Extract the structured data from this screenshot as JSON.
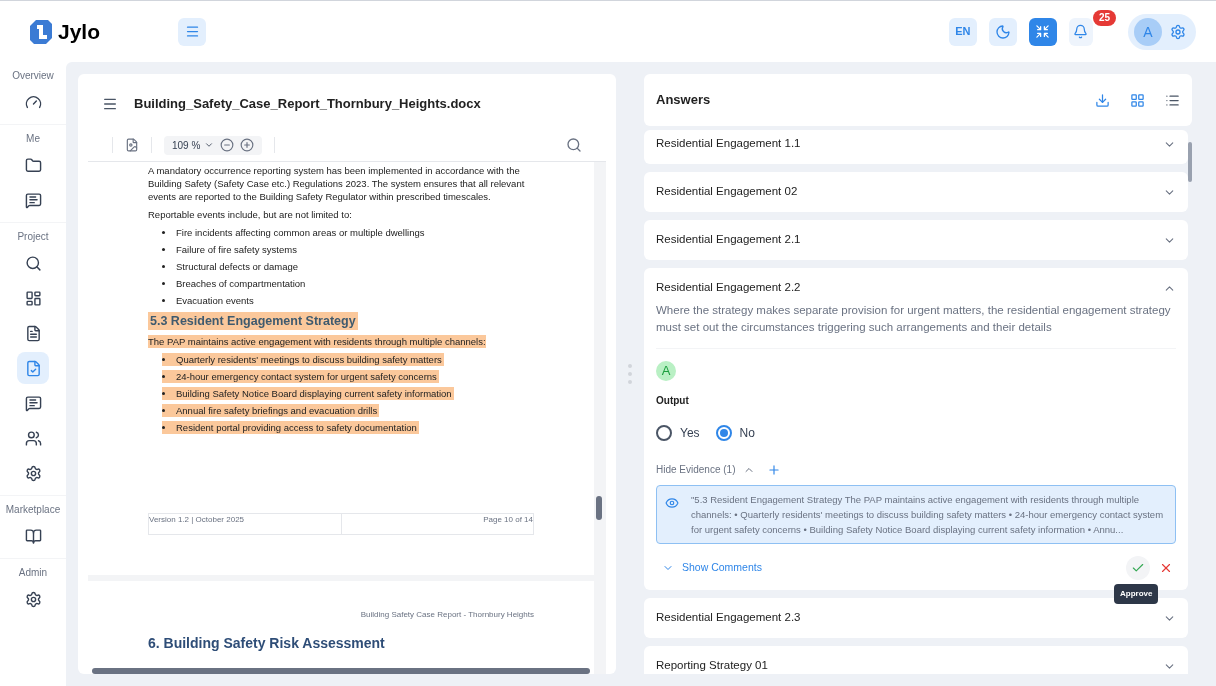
{
  "brand": {
    "name": "Jylo"
  },
  "header": {
    "language": "EN",
    "notifications": "25",
    "avatar": "A",
    "dark_mode": false,
    "fullscreen_active": true
  },
  "sidebar": {
    "sections": [
      {
        "label": "Overview",
        "items": [
          {
            "kind": "gauge",
            "selected": false
          }
        ]
      },
      {
        "label": "Me",
        "items": [
          {
            "kind": "folder",
            "selected": false
          },
          {
            "kind": "chat",
            "selected": false
          }
        ]
      },
      {
        "label": "Project",
        "items": [
          {
            "kind": "search",
            "selected": false
          },
          {
            "kind": "dashboard",
            "selected": false
          },
          {
            "kind": "document",
            "selected": false
          },
          {
            "kind": "checked-file",
            "selected": true
          },
          {
            "kind": "chat",
            "selected": false
          },
          {
            "kind": "users",
            "selected": false
          },
          {
            "kind": "gear",
            "selected": false
          }
        ]
      },
      {
        "label": "Marketplace",
        "items": [
          {
            "kind": "book",
            "selected": false
          }
        ]
      },
      {
        "label": "Admin",
        "items": [
          {
            "kind": "gear",
            "selected": false
          }
        ]
      }
    ]
  },
  "document": {
    "file_name": "Building_Safety_Case_Report_Thornbury_Heights.docx",
    "zoom": "109 %",
    "blocks": [
      {
        "kind": "paragraph",
        "text": "A mandatory occurrence reporting system has been implemented in accordance with the Building Safety (Safety Case etc.) Regulations 2023. The system ensures that all relevant events are reported to the Building Safety Regulator within prescribed timescales.",
        "highlighted": false
      },
      {
        "kind": "paragraph",
        "text": "Reportable events include, but are not limited to:",
        "highlighted": false
      },
      {
        "kind": "bullets",
        "items": [
          {
            "text": "Fire incidents affecting common areas or multiple dwellings",
            "highlighted": false
          },
          {
            "text": "Failure of fire safety systems",
            "highlighted": false
          },
          {
            "text": "Structural defects or damage",
            "highlighted": false
          },
          {
            "text": "Breaches of compartmentation",
            "highlighted": false
          },
          {
            "text": "Evacuation events",
            "highlighted": false
          }
        ]
      },
      {
        "kind": "heading",
        "text": "5.3 Resident Engagement Strategy",
        "highlighted": true
      },
      {
        "kind": "paragraph",
        "text": "The PAP maintains active engagement with residents through multiple channels:",
        "highlighted": true
      },
      {
        "kind": "bullets",
        "items": [
          {
            "text": "Quarterly residents' meetings to discuss building safety matters",
            "highlighted": true
          },
          {
            "text": "24-hour emergency contact system for urgent safety concerns",
            "highlighted": true
          },
          {
            "text": "Building Safety Notice Board displaying current safety information",
            "highlighted": true
          },
          {
            "text": "Annual fire safety briefings and evacuation drills",
            "highlighted": true
          },
          {
            "text": "Resident portal providing access to safety documentation",
            "highlighted": true
          }
        ]
      }
    ],
    "footer_left": "Version 1.2 | October 2025",
    "footer_right": "Page 10 of 14",
    "next_page_header": "Building Safety Case Report - Thornbury Heights",
    "next_page_heading": "6. Building Safety Risk Assessment"
  },
  "answers": {
    "title": "Answers",
    "items": [
      {
        "title": "Residential Engagement 1.1",
        "expanded": false
      },
      {
        "title": "Residential Engagement 02",
        "expanded": false
      },
      {
        "title": "Residential Engagement 2.1",
        "expanded": false
      },
      {
        "title": "Residential Engagement 2.2",
        "expanded": true,
        "description": "Where the strategy makes separate provision for urgent matters, the residential engagement strategy must set out the circumstances triggering such arrangements and their details",
        "avatar": "A",
        "output_label": "Output",
        "options": [
          {
            "label": "Yes",
            "selected": false
          },
          {
            "label": "No",
            "selected": true
          }
        ],
        "evidence_toggle": "Hide Evidence (1)",
        "evidence_open": true,
        "evidence": "\"5.3 Resident Engagement Strategy The PAP maintains active engagement with residents through multiple channels: • Quarterly residents' meetings to discuss building safety matters • 24-hour emergency contact system for urgent safety concerns • Building Safety Notice Board displaying current safety information • Annu...",
        "comments_toggle": "Show Comments",
        "tooltip": "Approve"
      },
      {
        "title": "Residential Engagement 2.3",
        "expanded": false
      },
      {
        "title": "Reporting Strategy 01",
        "expanded": false
      }
    ]
  }
}
